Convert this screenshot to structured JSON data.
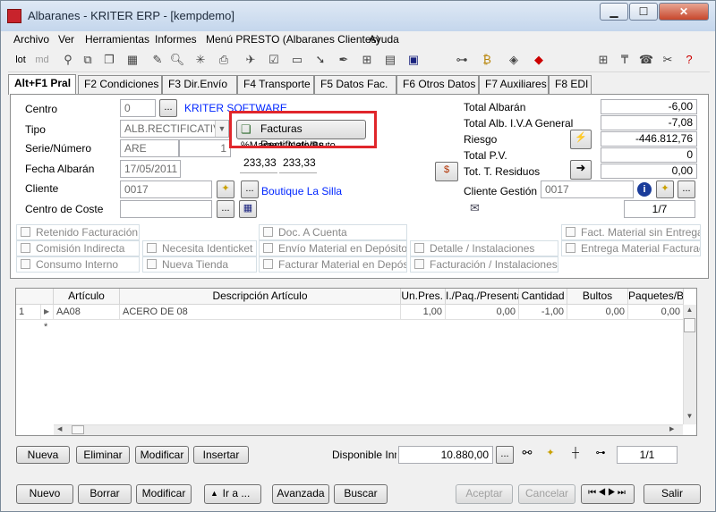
{
  "window": {
    "title": "Albaranes - KRITER ERP - [kempdemo]"
  },
  "menu": [
    "Archivo",
    "Ver",
    "Herramientas",
    "Informes",
    "Menú PRESTO (Albaranes Clientes)",
    "Ayuda"
  ],
  "toolbar": {
    "lot_label": "lot",
    "md_label": "md"
  },
  "tabs": [
    "Alt+F1 Pral",
    "F2 Condiciones",
    "F3 Dir.Envío",
    "F4 Transporte",
    "F5 Datos Fac.",
    "F6 Otros Datos",
    "F7 Auxiliares",
    "F8 EDI"
  ],
  "form": {
    "centro_label": "Centro",
    "centro_value": "0",
    "centro_name": "KRITER SOFTWARE",
    "tipo_label": "Tipo",
    "tipo_value": "ALB.RECTIFICATIVO",
    "serie_label": "Serie/Número",
    "serie_value": "ARE",
    "numero_value": "1",
    "fecha_label": "Fecha Albarán",
    "fecha_value": "17/05/2011",
    "cliente_label": "Cliente",
    "cliente_value": "0017",
    "cliente_name": "Boutique La Silla",
    "coste_label": "Centro de Coste",
    "facturas_button": "Facturas Rectificativas",
    "margen_label": "%Margen: Neto/Bruto",
    "margen_neto": "233,33",
    "margen_bruto": "233,33",
    "ellipsis": "..."
  },
  "totals": {
    "total_albaran_label": "Total Albarán",
    "total_albaran": "-6,00",
    "total_iva_label": "Total Alb. I.V.A General",
    "total_iva": "-7,08",
    "riesgo_label": "Riesgo",
    "riesgo": "-446.812,76",
    "total_pv_label": "Total P.V.",
    "total_pv": "0",
    "residuos_label": "Tot. T. Residuos",
    "residuos": "0,00",
    "cliente_gestion_label": "Cliente Gestión",
    "cliente_gestion": "0017",
    "pager": "1/7"
  },
  "checkboxes": [
    "Retenido Facturación",
    "Doc. A Cuenta",
    "Fact. Material sin Entrega",
    "Comisión Indirecta",
    "Necesita Identicket",
    "Envío Material en Depósito",
    "Detalle / Instalaciones",
    "Entrega Material Facturado",
    "Consumo Interno",
    "Nueva Tienda",
    "Facturar Material en Depósito",
    "Facturación / Instalaciones"
  ],
  "grid": {
    "columns": [
      "Artículo",
      "Descripción Artículo",
      "Un.Pres.",
      "I./Paq./Presenta",
      "Cantidad",
      "Bultos",
      "Paquetes/Bu"
    ],
    "rows": [
      {
        "num": "1",
        "articulo": "AA08",
        "descripcion": "ACERO DE 08",
        "unpres": "1,00",
        "paq": "0,00",
        "cantidad": "-1,00",
        "bultos": "0,00",
        "paquetes": "0,00"
      }
    ],
    "new_row_marker": "*"
  },
  "grid_buttons": {
    "nueva": "Nueva",
    "eliminar": "Eliminar",
    "modificar": "Modificar",
    "insertar": "Insertar",
    "disponible_label": "Disponible Inmed",
    "disponible_value": "10.880,00",
    "pager": "1/1"
  },
  "bottom_buttons": {
    "nuevo": "Nuevo",
    "borrar": "Borrar",
    "modificar": "Modificar",
    "ira": "Ir a ...",
    "avanzada": "Avanzada",
    "buscar": "Buscar",
    "aceptar": "Aceptar",
    "cancelar": "Cancelar",
    "salir": "Salir"
  }
}
